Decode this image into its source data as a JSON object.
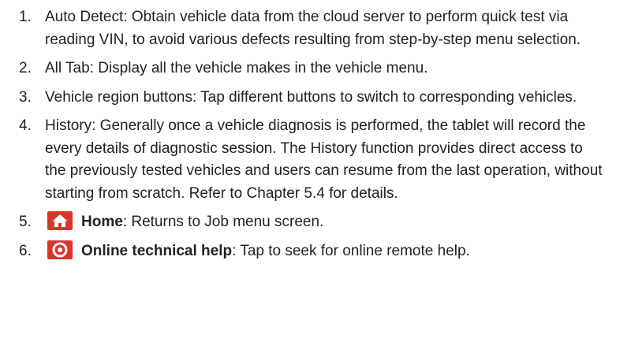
{
  "items": [
    {
      "number": "1.",
      "text": "Auto Detect: Obtain vehicle data from the cloud server to perform quick test via reading VIN, to avoid various defects resulting from step-by-step menu selection."
    },
    {
      "number": "2.",
      "text": "All Tab: Display all the vehicle makes in the vehicle menu."
    },
    {
      "number": "3.",
      "text": "Vehicle region buttons: Tap different buttons to switch to corresponding vehicles."
    },
    {
      "number": "4.",
      "text": "History: Generally once a vehicle diagnosis is performed, the tablet will record the every details of diagnostic session. The History function provides direct access to the previously tested vehicles and users can resume from the last operation, without starting from scratch. Refer to Chapter 5.4 for details."
    },
    {
      "number": "5.",
      "icon": "home-icon",
      "title": "Home",
      "rest": ": Returns to Job menu screen."
    },
    {
      "number": "6.",
      "icon": "online-help-icon",
      "title": "Online technical help",
      "rest": ": Tap to seek for online remote help."
    }
  ],
  "colors": {
    "icon_red": "#d9352b",
    "text": "#222222"
  }
}
